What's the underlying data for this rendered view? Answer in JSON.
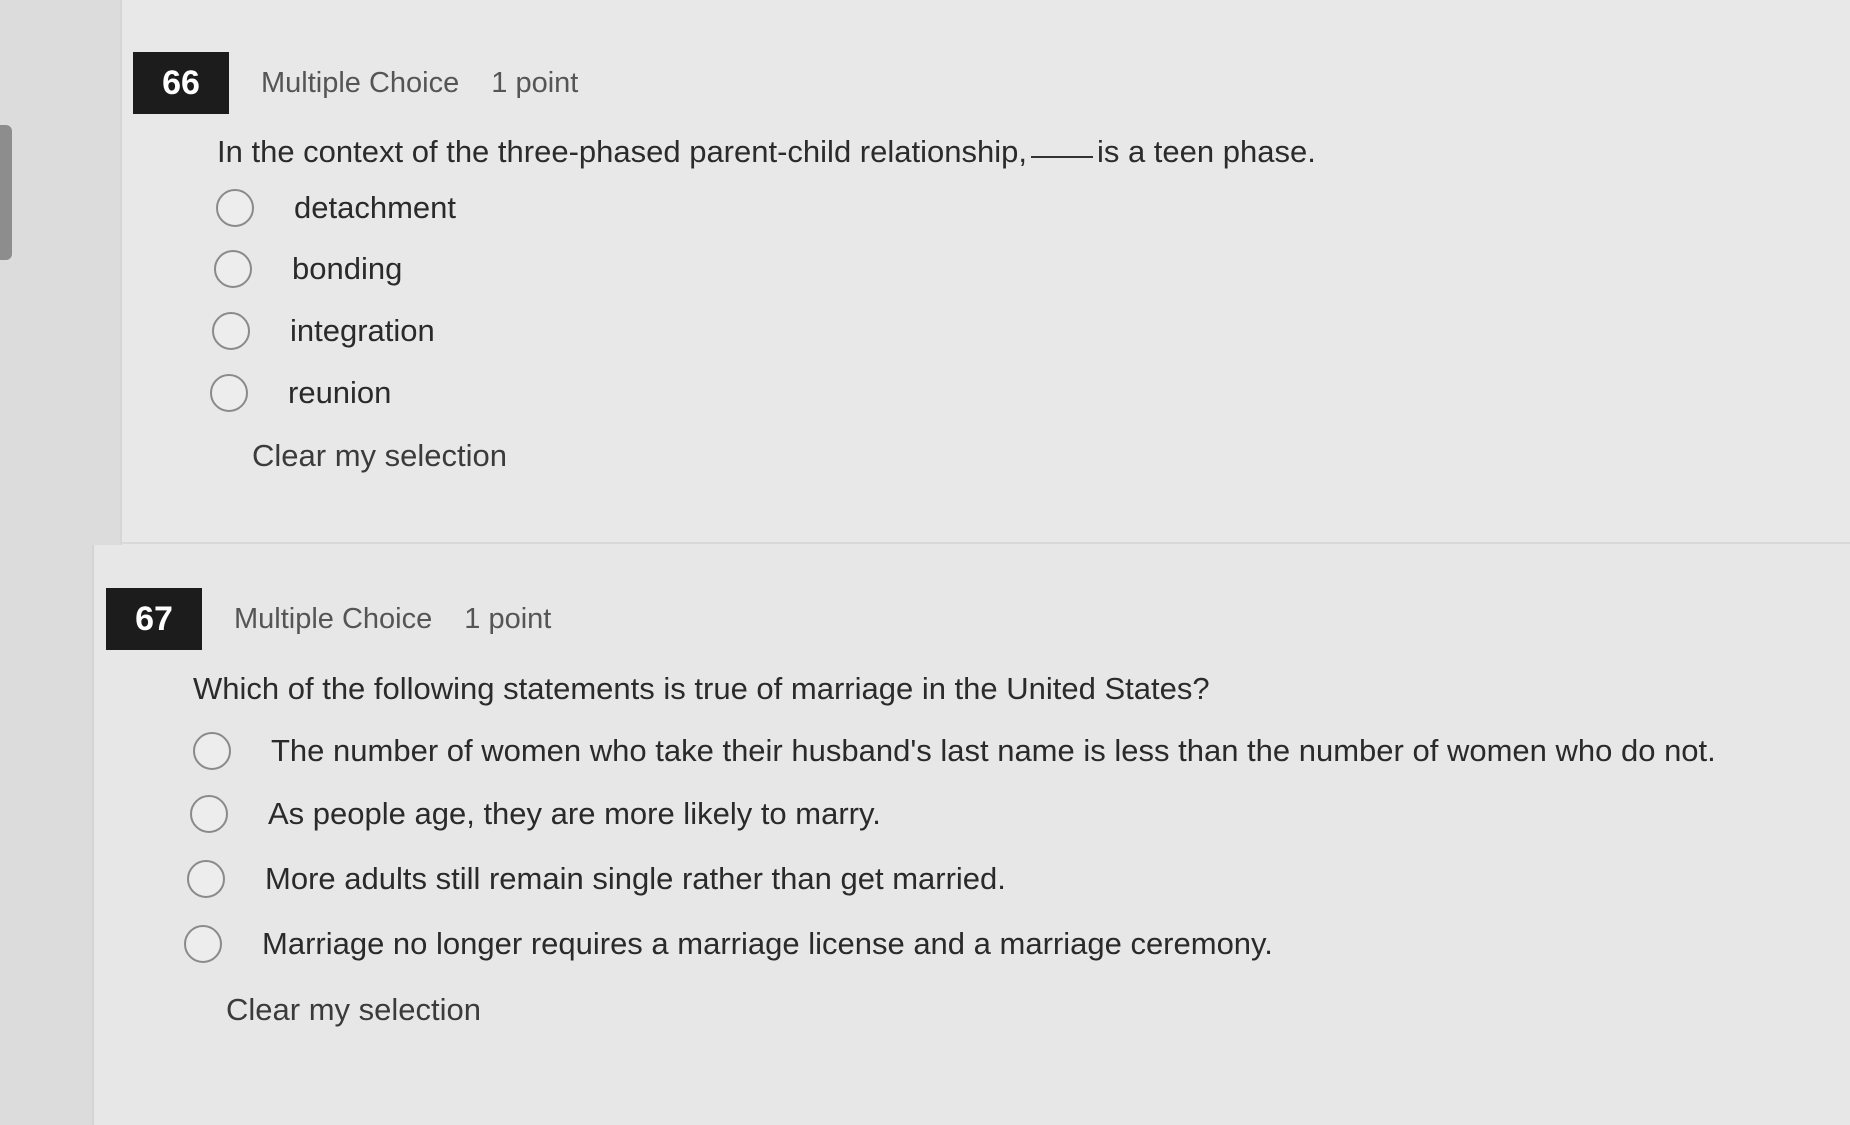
{
  "questions": [
    {
      "number": "66",
      "type": "Multiple Choice",
      "points": "1 point",
      "stem_before": "In the context of the three-phased parent-child relationship,",
      "stem_after": "is a teen phase.",
      "options": [
        "detachment",
        "bonding",
        "integration",
        "reunion"
      ],
      "clear_label": "Clear my selection"
    },
    {
      "number": "67",
      "type": "Multiple Choice",
      "points": "1 point",
      "stem": "Which of the following statements is true of marriage in the United States?",
      "options": [
        "The number of women who take their husband's last name is less than the number of women who do not.",
        "As people age, they are more likely to marry.",
        "More adults still remain single rather than get married.",
        "Marriage no longer requires a marriage license and a marriage ceremony."
      ],
      "clear_label": "Clear my selection"
    }
  ]
}
